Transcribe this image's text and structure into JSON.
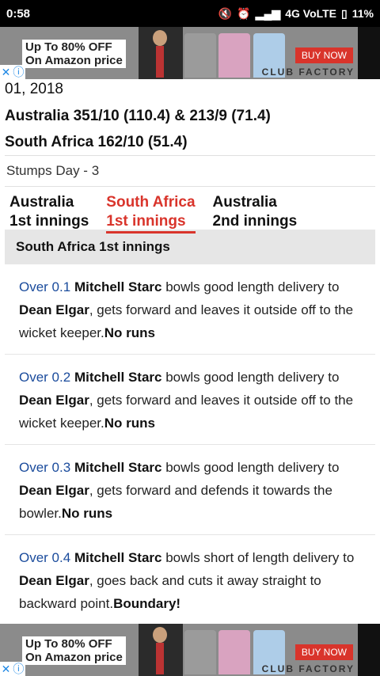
{
  "status": {
    "time": "0:58",
    "network": "4G VoLTE",
    "battery": "11%"
  },
  "ad": {
    "line1": "Up To 80% OFF",
    "line2": "On Amazon price",
    "buy": "BUY NOW",
    "brand": "CLUB FACTORY"
  },
  "match": {
    "date": "01, 2018",
    "score1": "Australia 351/10 (110.4)  &  213/9 (71.4)",
    "score2": "South Africa 162/10 (51.4)",
    "status": "Stumps Day - 3"
  },
  "tabs": [
    {
      "label": "Australia\n1st innings"
    },
    {
      "label": "South Africa\n1st innings"
    },
    {
      "label": "Australia\n2nd innings"
    }
  ],
  "section_title": "South Africa 1st innings",
  "commentary": [
    {
      "over": "Over 0.1",
      "bowler": "Mitchell Starc",
      "mid1": " bowls good length delivery to ",
      "batsman": "Dean Elgar",
      "mid2": ", gets forward and leaves it outside off to the wicket keeper.",
      "result": "No runs"
    },
    {
      "over": "Over 0.2",
      "bowler": "Mitchell Starc",
      "mid1": " bowls good length delivery to ",
      "batsman": "Dean Elgar",
      "mid2": ", gets forward and leaves it outside off to the wicket keeper.",
      "result": "No runs"
    },
    {
      "over": "Over 0.3",
      "bowler": "Mitchell Starc",
      "mid1": " bowls good length delivery to ",
      "batsman": "Dean Elgar",
      "mid2": ", gets forward and defends it towards the bowler.",
      "result": "No runs"
    },
    {
      "over": "Over 0.4",
      "bowler": "Mitchell Starc",
      "mid1": " bowls short of length delivery to ",
      "batsman": "Dean Elgar",
      "mid2": ", goes back and cuts it away straight to backward point.",
      "result": "Boundary!"
    }
  ]
}
